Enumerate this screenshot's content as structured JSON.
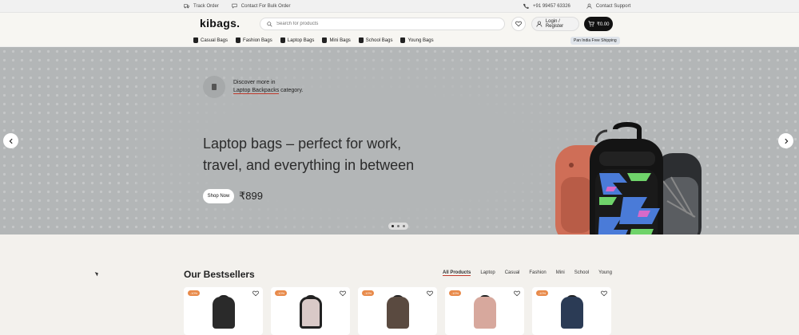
{
  "topbar": {
    "track_order": "Track Order",
    "bulk_order": "Contact For Bulk Order",
    "phone": "+91 99457 63326",
    "support": "Contact Support"
  },
  "header": {
    "logo": "kibags.",
    "search_placeholder": "Search for products",
    "login_label": "Login / Register",
    "cart_total": "₹0.00"
  },
  "categories": [
    {
      "label": "Casual Bags"
    },
    {
      "label": "Fashion Bags"
    },
    {
      "label": "Laptop Bags"
    },
    {
      "label": "Mini Bags"
    },
    {
      "label": "School Bags"
    },
    {
      "label": "Young Bags"
    }
  ],
  "shipping_badge": "Pan India Free Shipping",
  "hero": {
    "discover_line1": "Discover more in",
    "discover_link": "Laptop Backpacks",
    "discover_suffix": " category.",
    "headline": "Laptop bags – perfect for work, travel, and everything in between",
    "shop_button": "Shop Now",
    "price": "₹899",
    "slide_index": 1,
    "slide_count": 3
  },
  "bestsellers": {
    "title": "Our Bestsellers",
    "tabs": [
      "All Products",
      "Laptop",
      "Casual",
      "Fashion",
      "Mini",
      "School",
      "Young"
    ],
    "active_tab": "All Products",
    "products": [
      {
        "badge": "-10%",
        "color": "#2a2a2a"
      },
      {
        "badge": "-10%",
        "color": "#d9c9c7"
      },
      {
        "badge": "-10%",
        "color": "#5a4a40"
      },
      {
        "badge": "-10%",
        "color": "#d7a89d"
      },
      {
        "badge": "-10%",
        "color": "#2b3b55"
      }
    ]
  },
  "colors": {
    "accent": "#c0392b",
    "badge": "#e88a4a",
    "cart_bg": "#111111",
    "hero_bg": "#b3b6b7"
  }
}
